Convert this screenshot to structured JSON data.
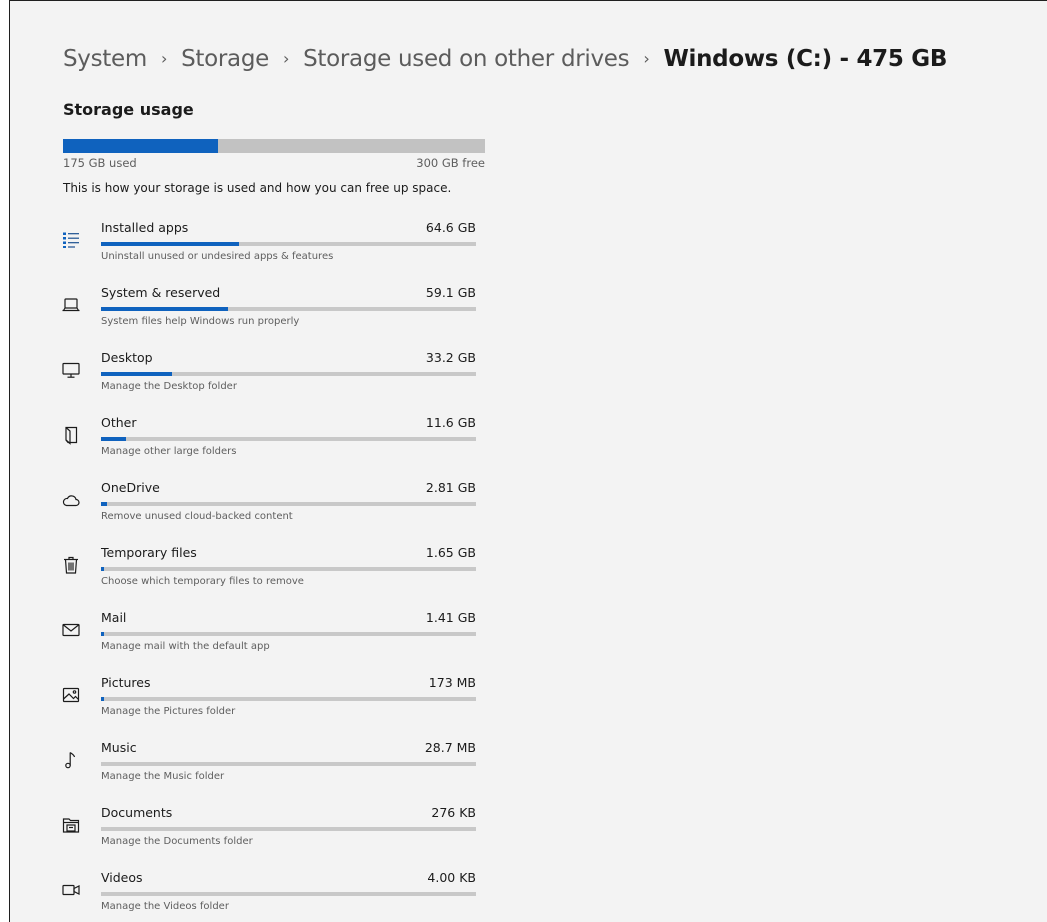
{
  "breadcrumb": {
    "items": [
      "System",
      "Storage",
      "Storage used on other drives"
    ],
    "current": "Windows (C:) - 475 GB",
    "separator": "›"
  },
  "section_title": "Storage usage",
  "usage": {
    "used_label": "175 GB used",
    "free_label": "300 GB free",
    "used_fraction": 0.368,
    "bar_color": "#0f62be",
    "track_color": "#c2c2c2"
  },
  "description": "This is how your storage is used and how you can free up space.",
  "categories": [
    {
      "name": "Installed apps",
      "size": "64.6 GB",
      "desc": "Uninstall unused or undesired apps & features",
      "icon": "apps-list-icon",
      "fraction": 0.369
    },
    {
      "name": "System & reserved",
      "size": "59.1 GB",
      "desc": "System files help Windows run properly",
      "icon": "laptop-icon",
      "fraction": 0.338
    },
    {
      "name": "Desktop",
      "size": "33.2 GB",
      "desc": "Manage the Desktop folder",
      "icon": "monitor-icon",
      "fraction": 0.19
    },
    {
      "name": "Other",
      "size": "11.6 GB",
      "desc": "Manage other large folders",
      "icon": "folder-open-icon",
      "fraction": 0.066
    },
    {
      "name": "OneDrive",
      "size": "2.81 GB",
      "desc": "Remove unused cloud-backed content",
      "icon": "cloud-icon",
      "fraction": 0.016
    },
    {
      "name": "Temporary files",
      "size": "1.65 GB",
      "desc": "Choose which temporary files to remove",
      "icon": "trash-icon",
      "fraction": 0.009
    },
    {
      "name": "Mail",
      "size": "1.41 GB",
      "desc": "Manage mail with the default app",
      "icon": "mail-icon",
      "fraction": 0.008
    },
    {
      "name": "Pictures",
      "size": "173 MB",
      "desc": "Manage the Pictures folder",
      "icon": "pictures-icon",
      "fraction": 0.001
    },
    {
      "name": "Music",
      "size": "28.7 MB",
      "desc": "Manage the Music folder",
      "icon": "music-note-icon",
      "fraction": 0.0
    },
    {
      "name": "Documents",
      "size": "276 KB",
      "desc": "Manage the Documents folder",
      "icon": "documents-icon",
      "fraction": 0.0
    },
    {
      "name": "Videos",
      "size": "4.00 KB",
      "desc": "Manage the Videos folder",
      "icon": "video-camera-icon",
      "fraction": 0.0
    }
  ]
}
